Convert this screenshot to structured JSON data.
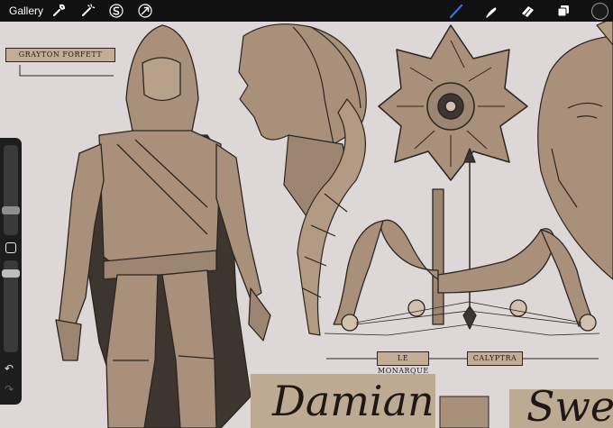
{
  "toolbar": {
    "gallery_label": "Gallery",
    "left_icons": [
      "wrench-icon",
      "magic-wand-icon",
      "selection-s-icon",
      "transform-arrow-icon"
    ],
    "right_icons": [
      "brush-icon",
      "smudge-icon",
      "eraser-icon",
      "layers-icon",
      "color-swatch"
    ],
    "active_tool": "brush-icon",
    "accent_color": "#3b6fe8",
    "current_color": "#1a1a1a"
  },
  "sidebar": {
    "brush_size_value": 0.77,
    "opacity_value": 0.3,
    "icons": [
      "modify-square-icon",
      "undo-icon",
      "redo-icon"
    ]
  },
  "canvas": {
    "labels": {
      "character": "GRAYTON FORFETT",
      "weapon_left": "LE MONARQUE",
      "weapon_right": "CALYPTRA"
    },
    "handwriting": {
      "name_left": "Damian",
      "name_right": "Swell"
    },
    "colors": {
      "paper": "#ddd8d7",
      "skin_tone": "#a8907a",
      "label_fill": "#c4ad96",
      "ink": "#2b2520"
    }
  }
}
